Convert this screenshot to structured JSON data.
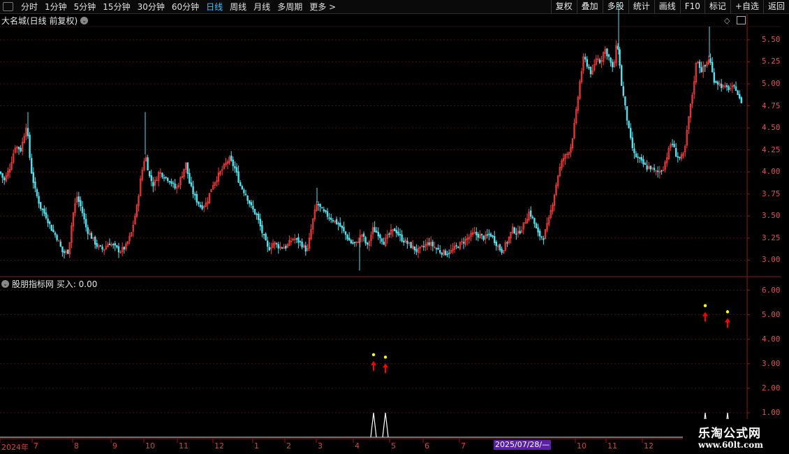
{
  "toolbar": {
    "periods": [
      "分时",
      "1分钟",
      "5分钟",
      "15分钟",
      "30分钟",
      "60分钟",
      "日线",
      "周线",
      "月线",
      "多周期",
      "更多 >"
    ],
    "active_period": "日线",
    "right_buttons": [
      "复权",
      "叠加",
      "多股",
      "统计",
      "画线",
      "F10",
      "标记",
      "+自选",
      "返回"
    ]
  },
  "main_panel": {
    "title": "大名城(日线 前复权)",
    "y_ticks": [
      "5.50",
      "5.25",
      "5.00",
      "4.75",
      "4.50",
      "4.25",
      "4.00",
      "3.75",
      "3.50",
      "3.25",
      "3.00"
    ]
  },
  "indicator_panel": {
    "title": "股朋指标网  买入: 0.00",
    "y_ticks": [
      "6.00",
      "5.00",
      "4.00",
      "3.00",
      "2.00",
      "1.00"
    ]
  },
  "time_axis": {
    "labels": [
      "2024年",
      "7",
      "8",
      "9",
      "10",
      "11",
      "12",
      "1",
      "2",
      "3",
      "4",
      "5",
      "6",
      "7",
      "10",
      "11",
      "12"
    ],
    "cursor_date": "2025/07/28/—"
  },
  "watermark": {
    "title": "乐淘公式网",
    "url": "www.60lt.com"
  },
  "colors": {
    "up": "#ff3b3b",
    "down": "#4fe3f0",
    "axis": "#8a1a1a",
    "accent": "#35c6ff",
    "signal": "#ff0000",
    "dot": "#ffff00"
  },
  "chart_data": {
    "type": "candlestick",
    "title": "大名城(日线 前复权)",
    "ylim": [
      2.9,
      5.65
    ],
    "close_path": [
      [
        0,
        4.0
      ],
      [
        6,
        3.9
      ],
      [
        14,
        4.05
      ],
      [
        22,
        4.3
      ],
      [
        30,
        4.25
      ],
      [
        38,
        4.55
      ],
      [
        44,
        4.05
      ],
      [
        50,
        3.8
      ],
      [
        58,
        3.6
      ],
      [
        66,
        3.5
      ],
      [
        74,
        3.35
      ],
      [
        82,
        3.25
      ],
      [
        90,
        3.08
      ],
      [
        98,
        3.1
      ],
      [
        104,
        3.5
      ],
      [
        110,
        3.72
      ],
      [
        116,
        3.6
      ],
      [
        124,
        3.35
      ],
      [
        132,
        3.25
      ],
      [
        140,
        3.15
      ],
      [
        148,
        3.12
      ],
      [
        156,
        3.2
      ],
      [
        164,
        3.15
      ],
      [
        172,
        3.1
      ],
      [
        180,
        3.15
      ],
      [
        188,
        3.3
      ],
      [
        196,
        3.6
      ],
      [
        202,
        3.95
      ],
      [
        208,
        4.2
      ],
      [
        214,
        3.95
      ],
      [
        220,
        3.85
      ],
      [
        228,
        4.0
      ],
      [
        236,
        3.95
      ],
      [
        244,
        3.9
      ],
      [
        252,
        3.8
      ],
      [
        260,
        3.95
      ],
      [
        266,
        4.1
      ],
      [
        272,
        3.85
      ],
      [
        280,
        3.7
      ],
      [
        288,
        3.6
      ],
      [
        296,
        3.65
      ],
      [
        304,
        3.85
      ],
      [
        312,
        3.95
      ],
      [
        320,
        4.05
      ],
      [
        328,
        4.15
      ],
      [
        336,
        4.05
      ],
      [
        344,
        3.85
      ],
      [
        352,
        3.75
      ],
      [
        360,
        3.6
      ],
      [
        368,
        3.5
      ],
      [
        376,
        3.3
      ],
      [
        384,
        3.12
      ],
      [
        392,
        3.2
      ],
      [
        400,
        3.15
      ],
      [
        410,
        3.15
      ],
      [
        420,
        3.25
      ],
      [
        430,
        3.2
      ],
      [
        440,
        3.1
      ],
      [
        448,
        3.45
      ],
      [
        454,
        3.65
      ],
      [
        462,
        3.55
      ],
      [
        470,
        3.5
      ],
      [
        478,
        3.45
      ],
      [
        486,
        3.4
      ],
      [
        494,
        3.3
      ],
      [
        502,
        3.2
      ],
      [
        510,
        3.18
      ],
      [
        518,
        3.3
      ],
      [
        526,
        3.15
      ],
      [
        534,
        3.35
      ],
      [
        542,
        3.3
      ],
      [
        550,
        3.2
      ],
      [
        558,
        3.3
      ],
      [
        566,
        3.35
      ],
      [
        574,
        3.25
      ],
      [
        582,
        3.2
      ],
      [
        590,
        3.15
      ],
      [
        598,
        3.1
      ],
      [
        606,
        3.15
      ],
      [
        614,
        3.2
      ],
      [
        622,
        3.15
      ],
      [
        630,
        3.1
      ],
      [
        638,
        3.08
      ],
      [
        646,
        3.1
      ],
      [
        654,
        3.15
      ],
      [
        662,
        3.2
      ],
      [
        670,
        3.25
      ],
      [
        678,
        3.3
      ],
      [
        686,
        3.28
      ],
      [
        694,
        3.25
      ],
      [
        702,
        3.3
      ],
      [
        710,
        3.2
      ],
      [
        718,
        3.1
      ],
      [
        726,
        3.2
      ],
      [
        734,
        3.35
      ],
      [
        742,
        3.3
      ],
      [
        750,
        3.4
      ],
      [
        758,
        3.55
      ],
      [
        764,
        3.45
      ],
      [
        770,
        3.3
      ],
      [
        778,
        3.25
      ],
      [
        786,
        3.45
      ],
      [
        794,
        3.75
      ],
      [
        800,
        4.0
      ],
      [
        806,
        4.15
      ],
      [
        812,
        4.2
      ],
      [
        818,
        4.3
      ],
      [
        824,
        4.6
      ],
      [
        830,
        5.0
      ],
      [
        836,
        5.3
      ],
      [
        842,
        5.2
      ],
      [
        848,
        5.1
      ],
      [
        854,
        5.3
      ],
      [
        860,
        5.25
      ],
      [
        866,
        5.4
      ],
      [
        872,
        5.3
      ],
      [
        878,
        5.15
      ],
      [
        884,
        5.5
      ],
      [
        890,
        5.0
      ],
      [
        896,
        4.7
      ],
      [
        902,
        4.4
      ],
      [
        908,
        4.2
      ],
      [
        914,
        4.15
      ],
      [
        920,
        4.1
      ],
      [
        926,
        4.05
      ],
      [
        932,
        4.05
      ],
      [
        938,
        4.0
      ],
      [
        944,
        4.0
      ],
      [
        950,
        4.05
      ],
      [
        956,
        4.2
      ],
      [
        962,
        4.35
      ],
      [
        968,
        4.2
      ],
      [
        974,
        4.15
      ],
      [
        980,
        4.2
      ],
      [
        986,
        4.6
      ],
      [
        992,
        4.9
      ],
      [
        998,
        5.3
      ],
      [
        1004,
        5.15
      ],
      [
        1010,
        5.2
      ],
      [
        1016,
        5.3
      ],
      [
        1022,
        5.05
      ],
      [
        1030,
        5.0
      ],
      [
        1038,
        4.95
      ],
      [
        1046,
        4.95
      ],
      [
        1054,
        4.95
      ],
      [
        1060,
        4.8
      ]
    ],
    "indicator": {
      "series": "买入",
      "value": 0.0,
      "ylim": [
        0,
        6.5
      ],
      "spikes": [
        [
          535,
          1.0
        ],
        [
          552,
          1.0
        ],
        [
          1010,
          1.0
        ],
        [
          1042,
          1.0
        ]
      ],
      "buy_arrows": [
        [
          535,
          3.0
        ],
        [
          552,
          2.9
        ],
        [
          1010,
          5.0
        ],
        [
          1042,
          4.75
        ]
      ]
    }
  }
}
